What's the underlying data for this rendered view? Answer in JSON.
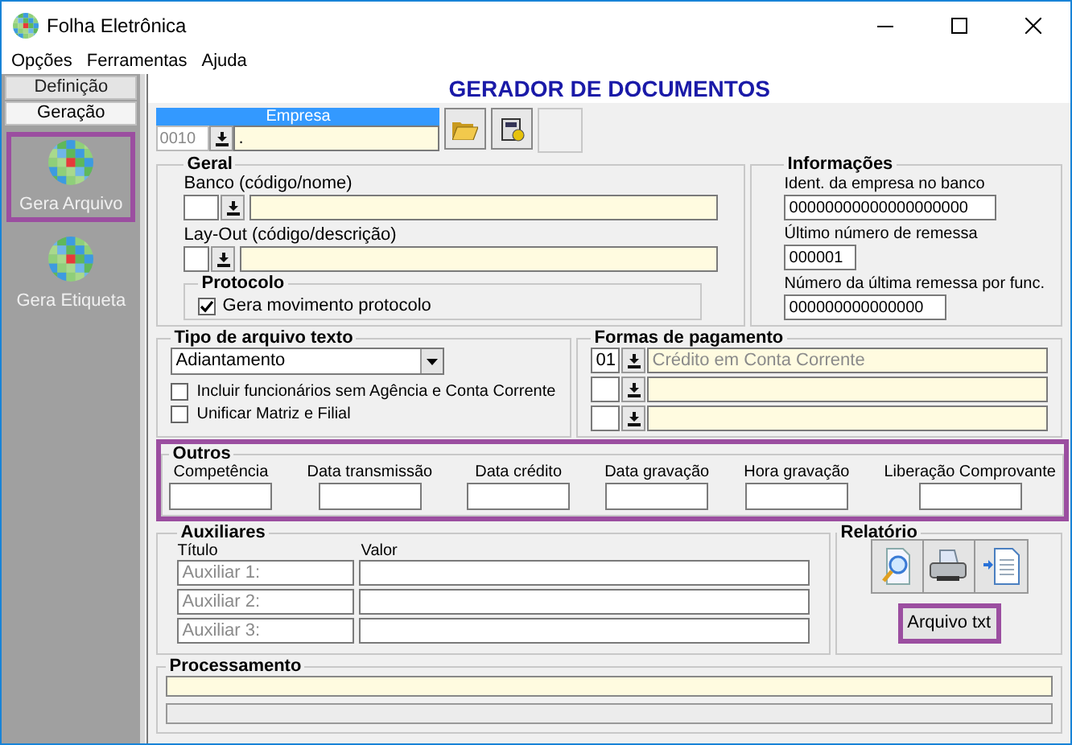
{
  "window": {
    "title": "Folha Eletrônica"
  },
  "menu": [
    "Opções",
    "Ferramentas",
    "Ajuda"
  ],
  "sidebar": {
    "sections": [
      {
        "label": "Definição",
        "selected": false
      },
      {
        "label": "Geração",
        "selected": true
      }
    ],
    "items": [
      {
        "label": "Gera Arquivo",
        "highlighted": true
      },
      {
        "label": "Gera Etiqueta",
        "highlighted": false
      }
    ]
  },
  "header": "GERADOR DE DOCUMENTOS",
  "empresa": {
    "label": "Empresa",
    "code": "0010",
    "name": "."
  },
  "geral": {
    "title": "Geral",
    "banco_label": "Banco (código/nome)",
    "layout_label": "Lay-Out (código/descrição)",
    "protocolo": {
      "title": "Protocolo",
      "label": "Gera movimento protocolo",
      "checked": true
    }
  },
  "informacoes": {
    "title": "Informações",
    "fields": [
      {
        "label": "Ident. da empresa no banco",
        "value": "00000000000000000000"
      },
      {
        "label": "Último número de remessa",
        "value": "000001"
      },
      {
        "label": "Número da última remessa por func.",
        "value": "000000000000000"
      }
    ]
  },
  "tipo": {
    "title": "Tipo de arquivo texto",
    "value": "Adiantamento",
    "options": [
      {
        "label": "Incluir funcionários sem Agência e Conta Corrente",
        "checked": false
      },
      {
        "label": "Unificar Matriz e Filial",
        "checked": false
      }
    ]
  },
  "formas": {
    "title": "Formas de pagamento",
    "rows": [
      {
        "kind": "filled",
        "code": "01",
        "description": "Crédito em Conta Corrente"
      },
      {
        "kind": "empty"
      },
      {
        "kind": "empty"
      }
    ]
  },
  "outros": {
    "title": "Outros",
    "highlighted": true,
    "fields": [
      "Competência",
      "Data transmissão",
      "Data crédito",
      "Data gravação",
      "Hora gravação",
      "Liberação Comprovante"
    ]
  },
  "auxiliares": {
    "title": "Auxiliares",
    "columns": [
      "Título",
      "Valor"
    ],
    "rows": [
      {
        "placeholder": "Auxiliar 1:"
      },
      {
        "placeholder": "Auxiliar 2:"
      },
      {
        "placeholder": "Auxiliar 3:"
      }
    ]
  },
  "relatorio": {
    "title": "Relatório",
    "button": {
      "label": "Arquivo txt",
      "highlighted": true
    }
  },
  "processamento": {
    "title": "Processamento",
    "level": 0
  }
}
